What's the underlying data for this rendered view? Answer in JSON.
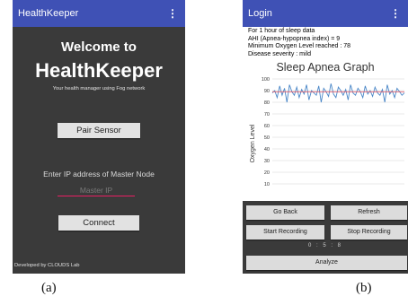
{
  "phone_a": {
    "app_title": "HealthKeeper",
    "menu_glyph": "⋮",
    "welcome": "Welcome to",
    "brand": "HealthKeeper",
    "tagline": "Your health manager using Fog network",
    "pair_button": "Pair Sensor",
    "ip_label": "Enter IP address of Master Node",
    "ip_placeholder": "Master IP",
    "ip_value": "",
    "connect_button": "Connect",
    "footer": "Developed by CLOUDS Lab"
  },
  "phone_b": {
    "app_title": "Login",
    "menu_glyph": "⋮",
    "stats": {
      "line1": "For 1 hour of sleep data",
      "line2": "AHI (Apnea-hypopnea index) = 9",
      "line3": "Minimum Oxygen Level reached : 78",
      "line4": "Disease severity : mild"
    },
    "buttons": {
      "go_back": "Go Back",
      "refresh": "Refresh",
      "start_recording": "Start Recording",
      "stop_recording": "Stop Recording",
      "analyze": "Analyze"
    },
    "timer": "0 : 5 : 8"
  },
  "captions": {
    "a": "(a)",
    "b": "(b)"
  },
  "colors": {
    "appbar": "#3f51b5",
    "screen_bg": "#3a3a3a",
    "input_underline": "#e91e63",
    "series_blue": "#4a87c8",
    "series_red": "#e05a6a"
  },
  "chart_data": {
    "type": "line",
    "title": "Sleep Apnea Graph",
    "xlabel": "",
    "ylabel": "Oxygen Level",
    "ylim": [
      0,
      100
    ],
    "yticks": [
      10,
      20,
      30,
      40,
      50,
      60,
      70,
      80,
      90,
      100
    ],
    "grid": true,
    "legend": "none",
    "series": [
      {
        "color": "#4a87c8",
        "values": [
          88,
          90,
          84,
          94,
          86,
          92,
          80,
          95,
          89,
          86,
          93,
          84,
          91,
          87,
          95,
          82,
          90,
          88,
          86,
          94,
          80,
          92,
          89,
          85,
          96,
          87,
          84,
          93,
          90,
          86,
          91,
          82,
          95,
          88,
          86,
          92,
          89,
          84,
          94,
          87,
          90,
          85,
          93,
          88,
          86,
          91,
          80,
          95,
          87,
          90,
          84,
          92,
          89,
          86,
          88
        ]
      },
      {
        "color": "#e05a6a",
        "values": [
          89,
          89,
          89,
          89,
          89,
          89,
          89,
          89,
          89,
          89,
          89,
          89,
          89,
          89,
          89,
          89,
          89,
          89,
          89,
          89,
          89,
          89,
          89,
          89,
          89,
          89,
          89,
          89,
          89,
          89,
          89,
          89,
          89,
          89,
          89,
          89,
          89,
          89,
          89,
          89,
          89,
          89,
          89,
          89,
          89,
          89,
          89,
          89,
          89,
          89,
          89,
          89,
          89,
          89,
          89
        ]
      }
    ]
  }
}
